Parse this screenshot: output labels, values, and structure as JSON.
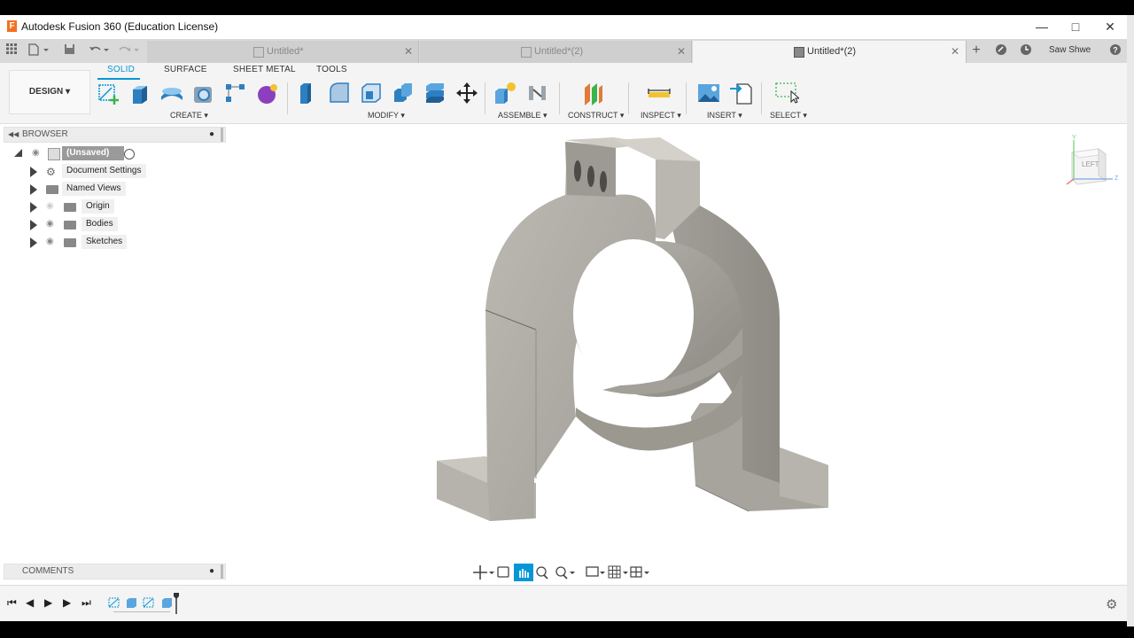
{
  "window": {
    "title": "Autodesk Fusion 360 (Education License)",
    "logo_letter": "F"
  },
  "tabs": [
    {
      "label": "Untitled*",
      "active": false
    },
    {
      "label": "Untitled*(2)",
      "active": false
    },
    {
      "label": "Untitled*(2)",
      "active": true
    }
  ],
  "user": {
    "name": "Saw Shwe"
  },
  "ribbon": {
    "workspace": "DESIGN",
    "tabs": [
      "SOLID",
      "SURFACE",
      "SHEET METAL",
      "TOOLS"
    ],
    "active_tab": "SOLID",
    "groups": [
      "CREATE",
      "MODIFY",
      "ASSEMBLE",
      "CONSTRUCT",
      "INSPECT",
      "INSERT",
      "SELECT"
    ]
  },
  "browser": {
    "title": "BROWSER",
    "root": "(Unsaved)",
    "items": [
      "Document Settings",
      "Named Views",
      "Origin",
      "Bodies",
      "Sketches"
    ]
  },
  "viewcube": {
    "face_label": "LEFT",
    "axes": [
      "Y",
      "Z"
    ]
  },
  "comments": {
    "title": "COMMENTS"
  },
  "colors": {
    "accent": "#0696d7",
    "part": "#a9a79e",
    "part_light": "#c7c5bd",
    "part_dark": "#8e8c84",
    "ribbon_bg": "#f4f4f4"
  },
  "icons": [
    "apps-grid-icon",
    "file-icon",
    "save-icon",
    "undo-icon",
    "redo-icon",
    "new-tab-icon",
    "job-status-icon",
    "clock-icon",
    "help-icon",
    "settings-icon"
  ]
}
